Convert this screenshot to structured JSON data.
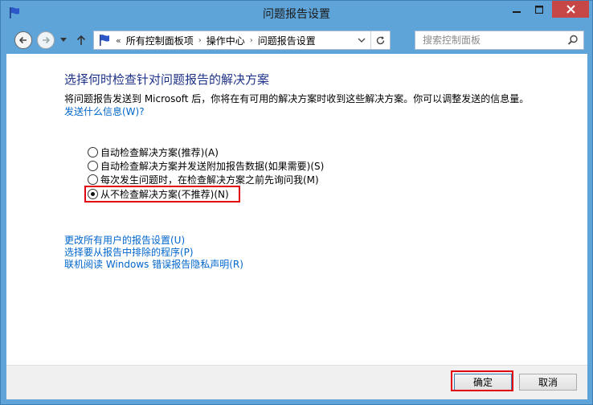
{
  "window": {
    "title": "问题报告设置",
    "accent_color": "#5ea4d9",
    "close_color": "#c74646"
  },
  "icons": {
    "app": "flag-icon",
    "minimize": "minimize-icon",
    "maximize": "maximize-icon",
    "close": "close-icon",
    "back": "back-arrow-icon",
    "forward": "forward-arrow-icon",
    "recent": "chevron-down-icon",
    "up": "up-arrow-icon",
    "refresh": "refresh-icon",
    "search": "search-icon"
  },
  "address": {
    "chevron": "«",
    "crumbs": [
      "所有控制面板项",
      "操作中心",
      "问题报告设置"
    ],
    "separator": "›"
  },
  "search": {
    "placeholder": "搜索控制面板"
  },
  "main": {
    "heading": "选择何时检查针对问题报告的解决方案",
    "description": "将问题报告发送到 Microsoft 后，你将在有可用的解决方案时收到这些解决方案。你可以调整发送的信息量。",
    "what_sent_link": "发送什么信息(W)?",
    "options": [
      {
        "label": "自动检查解决方案(推荐)(A)",
        "checked": false
      },
      {
        "label": "自动检查解决方案并发送附加报告数据(如果需要)(S)",
        "checked": false
      },
      {
        "label": "每次发生问题时，在检查解决方案之前先询问我(M)",
        "checked": false
      },
      {
        "label": "从不检查解决方案(不推荐)(N)",
        "checked": true
      }
    ],
    "links": [
      "更改所有用户的报告设置(U)",
      "选择要从报告中排除的程序(P)",
      "联机阅读 Windows 错误报告隐私声明(R)"
    ],
    "highlight_color": "#e3000f",
    "link_color": "#0066cc",
    "heading_color": "#1e3287"
  },
  "footer": {
    "ok_label": "确定",
    "cancel_label": "取消"
  }
}
